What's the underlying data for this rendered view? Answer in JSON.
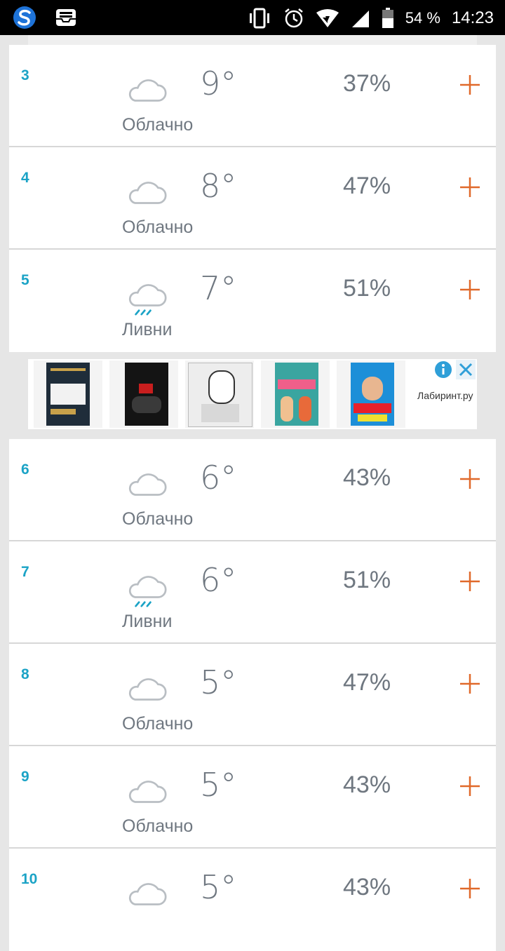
{
  "status_bar": {
    "battery": "54 %",
    "time": "14:23"
  },
  "ad": {
    "brand": "Лабиринт.ру"
  },
  "colors": {
    "hour": "#1ba3c6",
    "plus": "#e0692a",
    "text": "#6f7780"
  },
  "forecast_top": [
    {
      "hour": "3",
      "condition": "Облачно",
      "icon": "cloud-icon",
      "temp": "9°",
      "humidity": "37%"
    },
    {
      "hour": "4",
      "condition": "Облачно",
      "icon": "cloud-icon",
      "temp": "8°",
      "humidity": "47%"
    },
    {
      "hour": "5",
      "condition": "Ливни",
      "icon": "rain-cloud-icon",
      "temp": "7°",
      "humidity": "51%"
    }
  ],
  "forecast_bottom": [
    {
      "hour": "6",
      "condition": "Облачно",
      "icon": "cloud-icon",
      "temp": "6°",
      "humidity": "43%"
    },
    {
      "hour": "7",
      "condition": "Ливни",
      "icon": "rain-cloud-icon",
      "temp": "6°",
      "humidity": "51%"
    },
    {
      "hour": "8",
      "condition": "Облачно",
      "icon": "cloud-icon",
      "temp": "5°",
      "humidity": "47%"
    },
    {
      "hour": "9",
      "condition": "Облачно",
      "icon": "cloud-icon",
      "temp": "5°",
      "humidity": "43%"
    },
    {
      "hour": "10",
      "condition": "",
      "icon": "cloud-icon",
      "temp": "5°",
      "humidity": "43%"
    }
  ]
}
